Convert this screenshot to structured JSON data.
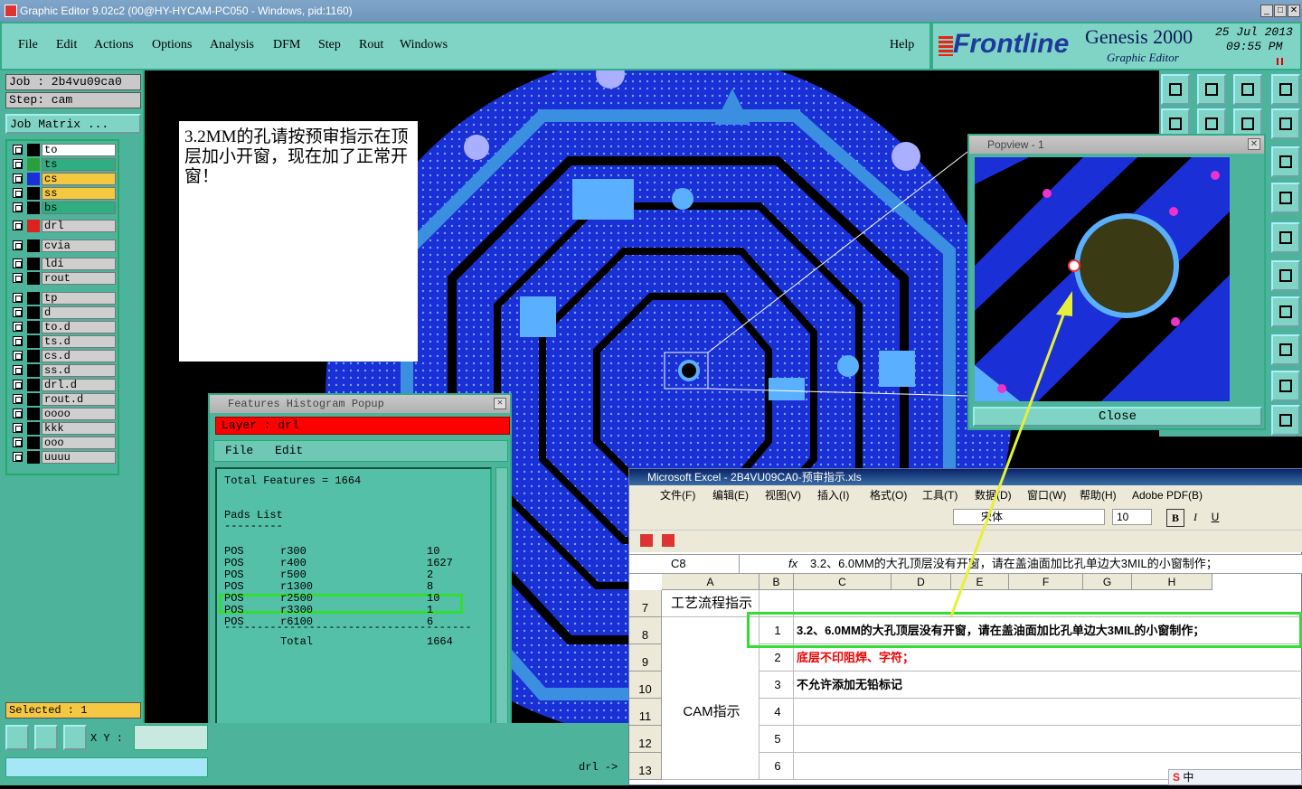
{
  "window": {
    "title": "Graphic Editor 9.02c2 (00@HY-HYCAM-PC050 - Windows, pid:1160)"
  },
  "menubar": {
    "items": [
      "File",
      "Edit",
      "Actions",
      "Options",
      "Analysis",
      "DFM",
      "Step",
      "Rout",
      "Windows"
    ],
    "help": "Help"
  },
  "brand": {
    "logo": "Frontline",
    "product": "Genesis 2000",
    "subtitle": "Graphic Editor",
    "date": "25 Jul 2013",
    "time": "09:55 PM"
  },
  "job": {
    "job_label": "Job : 2b4vu09ca0",
    "step_label": "Step: cam",
    "matrix_button": "Job Matrix ..."
  },
  "layers": [
    {
      "name": "to",
      "color": "#ffffff",
      "swatch": "#000000"
    },
    {
      "name": "ts",
      "color": "#2fae82",
      "swatch": "#2a9e3a"
    },
    {
      "name": "cs",
      "color": "#f5c842",
      "swatch": "#1c2ed8"
    },
    {
      "name": "ss",
      "color": "#f5c842",
      "swatch": "#000000"
    },
    {
      "name": "bs",
      "color": "#2fae82",
      "swatch": "#000000"
    },
    {
      "name": "drl",
      "color": "#cfcfcf",
      "swatch": "#d22"
    },
    {
      "name": "cvia",
      "color": "#cfcfcf",
      "swatch": "#000000"
    },
    {
      "name": "ldi",
      "color": "#cfcfcf",
      "swatch": "#000000"
    },
    {
      "name": "rout",
      "color": "#cfcfcf",
      "swatch": "#000000"
    },
    {
      "name": "tp",
      "color": "#cfcfcf",
      "swatch": "#000000"
    },
    {
      "name": "d",
      "color": "#cfcfcf",
      "swatch": "#000000"
    },
    {
      "name": "to.d",
      "color": "#cfcfcf",
      "swatch": "#000000"
    },
    {
      "name": "ts.d",
      "color": "#cfcfcf",
      "swatch": "#000000"
    },
    {
      "name": "cs.d",
      "color": "#cfcfcf",
      "swatch": "#000000"
    },
    {
      "name": "ss.d",
      "color": "#cfcfcf",
      "swatch": "#000000"
    },
    {
      "name": "drl.d",
      "color": "#cfcfcf",
      "swatch": "#000000"
    },
    {
      "name": "rout.d",
      "color": "#cfcfcf",
      "swatch": "#000000"
    },
    {
      "name": "oooo",
      "color": "#cfcfcf",
      "swatch": "#000000"
    },
    {
      "name": "kkk",
      "color": "#cfcfcf",
      "swatch": "#000000"
    },
    {
      "name": "ooo",
      "color": "#cfcfcf",
      "swatch": "#000000"
    },
    {
      "name": "uuuu",
      "color": "#cfcfcf",
      "swatch": "#000000"
    }
  ],
  "status": {
    "selected": "Selected : 1",
    "xy_label": "X Y :",
    "layer_indicator": "drl ->"
  },
  "note": {
    "text": "3.2MM的孔请按预审指示在顶层加小开窗，现在加了正常开窗！"
  },
  "histogram": {
    "title": "Features Histogram Popup",
    "layer": "Layer :  drl",
    "menu": [
      "File",
      "Edit"
    ],
    "total_features": "Total Features = 1664",
    "section": "Pads List",
    "rows": [
      {
        "type": "POS",
        "sym": "r300",
        "count": "10"
      },
      {
        "type": "POS",
        "sym": "r400",
        "count": "1627"
      },
      {
        "type": "POS",
        "sym": "r500",
        "count": "2"
      },
      {
        "type": "POS",
        "sym": "r1300",
        "count": "8"
      },
      {
        "type": "POS",
        "sym": "r2500",
        "count": "10"
      },
      {
        "type": "POS",
        "sym": "r3300",
        "count": "1"
      },
      {
        "type": "POS",
        "sym": "r6100",
        "count": "6"
      }
    ],
    "total_label": "Total",
    "total_value": "1664"
  },
  "popview": {
    "title": "Popview - 1",
    "close": "Close"
  },
  "excel": {
    "title": "Microsoft Excel - 2B4VU09CA0-预审指示.xls",
    "menu": [
      "文件(F)",
      "编辑(E)",
      "视图(V)",
      "插入(I)",
      "格式(O)",
      "工具(T)",
      "数据(D)",
      "窗口(W)",
      "帮助(H)",
      "Adobe PDF(B)"
    ],
    "font": "宋体",
    "size": "10",
    "cell_ref": "C8",
    "formula": "3.2、6.0MM的大孔顶层没有开窗，请在盖油面加比孔单边大3MIL的小窗制作；",
    "columns": [
      "A",
      "B",
      "C",
      "D",
      "E",
      "F",
      "G",
      "H"
    ],
    "rows": [
      {
        "num": "7",
        "a": "工艺流程指示",
        "b": "",
        "c": ""
      },
      {
        "num": "8",
        "a": "",
        "b": "1",
        "c": "3.2、6.0MM的大孔顶层没有开窗，请在盖油面加比孔单边大3MIL的小窗制作；"
      },
      {
        "num": "9",
        "a": "",
        "b": "2",
        "c": "底层不印阻焊、字符；"
      },
      {
        "num": "10",
        "a": "",
        "b": "3",
        "c": "不允许添加无铅标记"
      },
      {
        "num": "11",
        "a": "CAM指示",
        "b": "4",
        "c": ""
      },
      {
        "num": "12",
        "a": "",
        "b": "5",
        "c": ""
      },
      {
        "num": "13",
        "a": "",
        "b": "6",
        "c": ""
      }
    ]
  },
  "taskbar": {
    "ime": "中"
  }
}
